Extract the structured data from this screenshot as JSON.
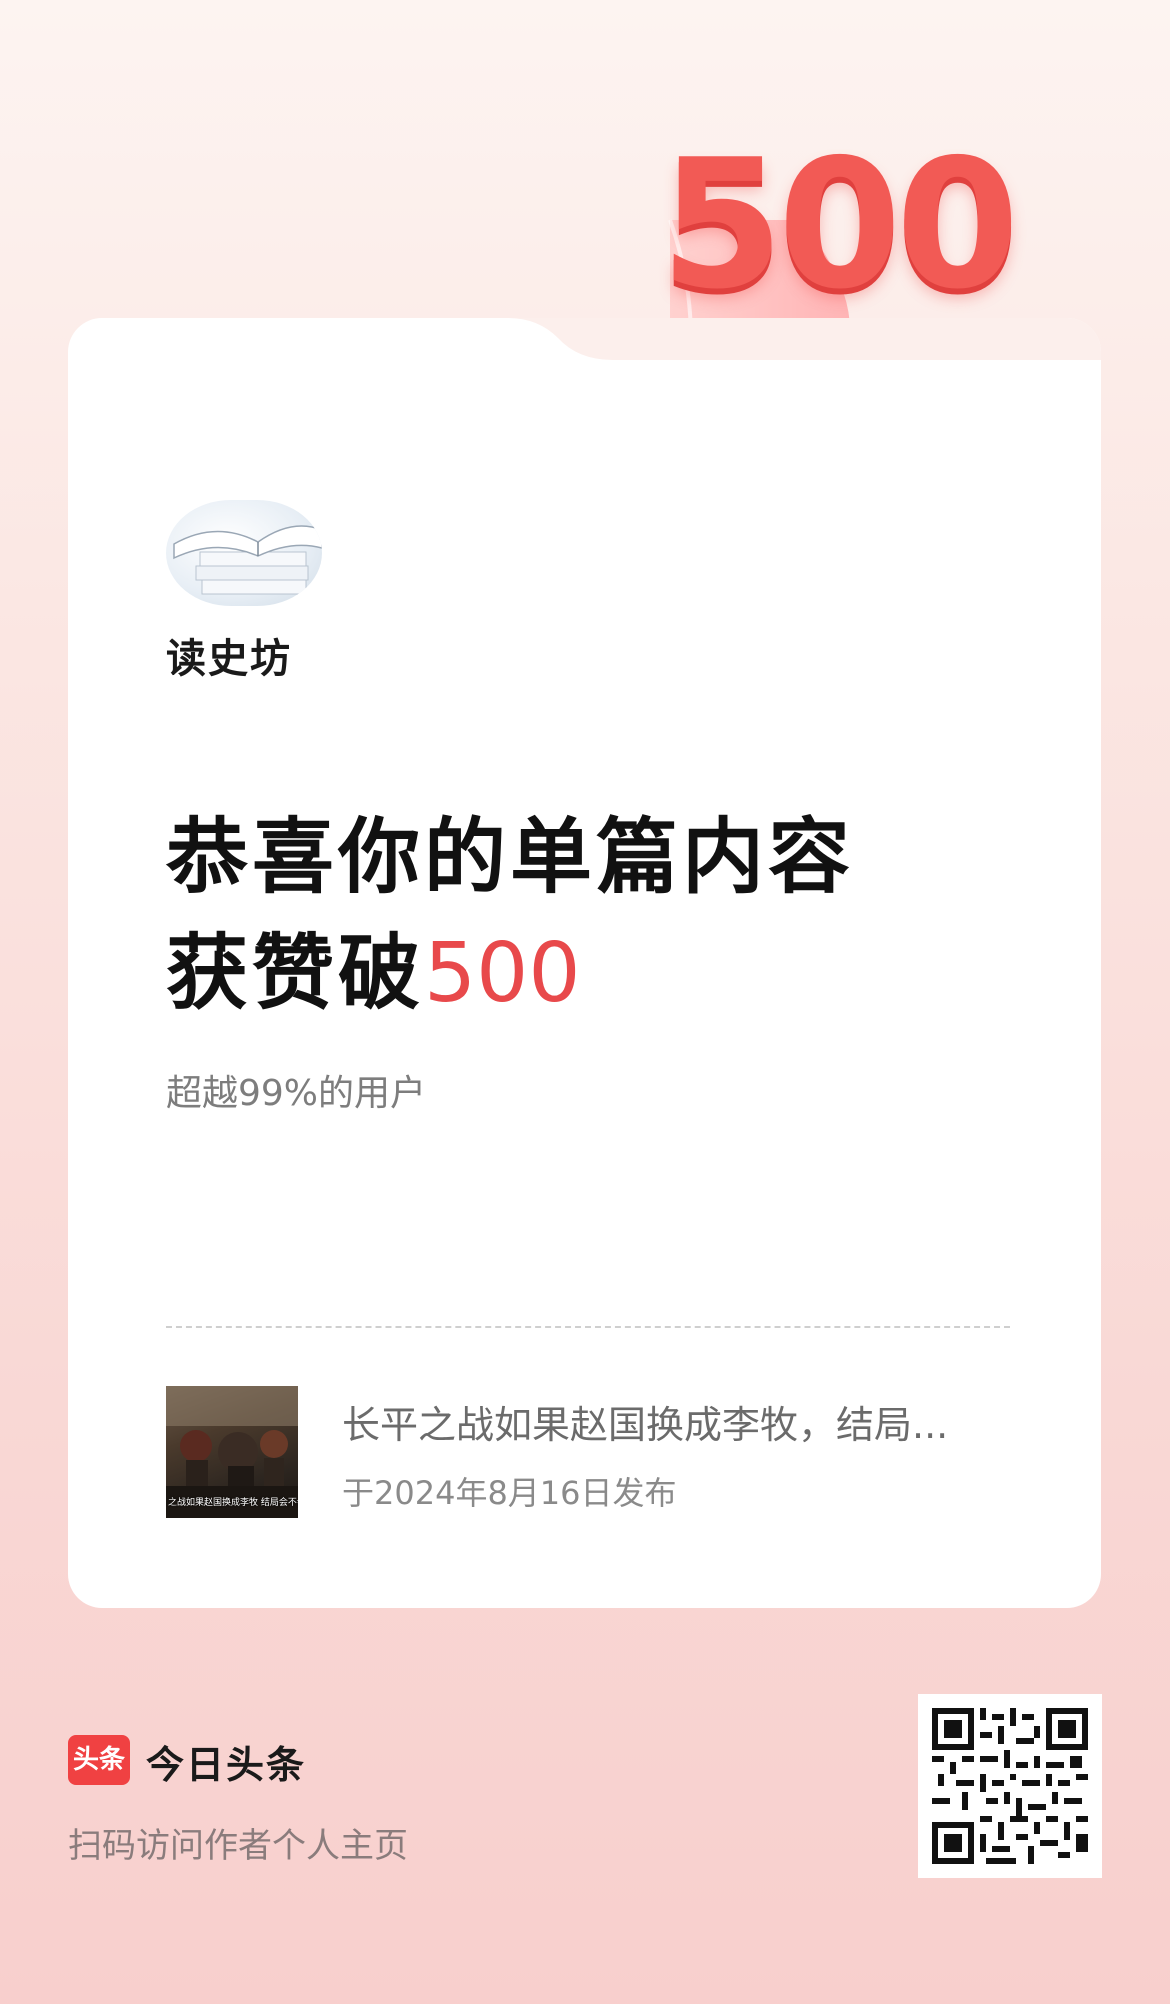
{
  "badge": {
    "number": "500",
    "icon": "heart-icon"
  },
  "author": {
    "name": "读史坊",
    "avatar_icon": "open-book-avatar"
  },
  "headline": {
    "line1": "恭喜你的单篇内容",
    "line2_prefix": "获赞破",
    "line2_number": "500"
  },
  "subtitle": "超越99%的用户",
  "article": {
    "title": "长平之战如果赵国换成李牧，结局...",
    "date": "于2024年8月16日发布",
    "thumb_caption": "之战如果赵国换成李牧 结局会不会不"
  },
  "footer": {
    "logo_text": "头条",
    "brand": "今日头条",
    "hint": "扫码访问作者个人主页",
    "qr_icon": "qr-code-icon"
  },
  "colors": {
    "accent": "#e8494b",
    "brand": "#f04142"
  }
}
